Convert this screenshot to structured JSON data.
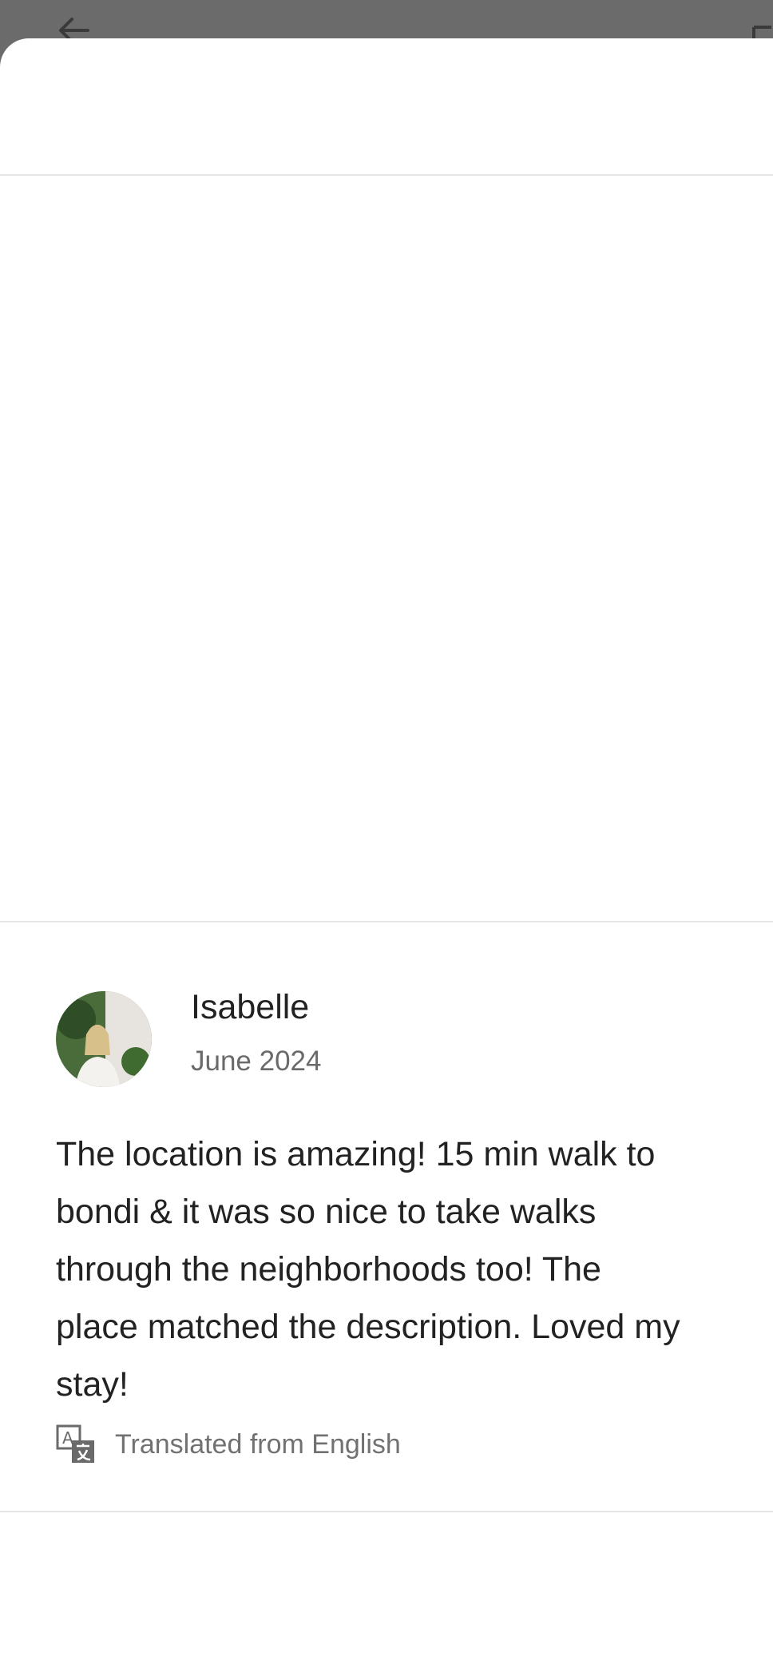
{
  "review": {
    "reviewer_name": "Isabelle",
    "date": "June 2024",
    "text_lines": [
      "The location is amazing! 15 min walk to",
      "bondi & it was so nice to take walks",
      "through the neighborhoods too! The",
      "place matched the description. Loved my",
      "stay!"
    ],
    "translation_note": "Translated from English"
  },
  "icons": {
    "back": "back-arrow-icon",
    "translate": "translate-icon"
  },
  "colors": {
    "backdrop": "#6b6b6b",
    "sheet": "#ffffff",
    "text_primary": "#222222",
    "text_secondary": "#717171"
  }
}
